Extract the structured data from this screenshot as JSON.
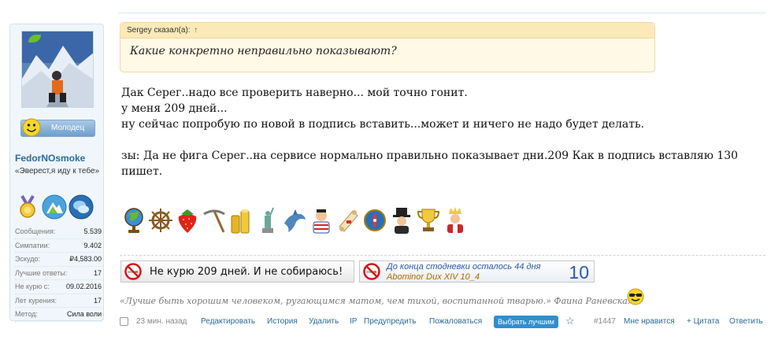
{
  "user": {
    "rank_label": "Молодец",
    "username": "FedorNOsmoke",
    "title": "«Эверест,я иду к тебе»",
    "stats": [
      {
        "key": "Сообщения:",
        "value": "5.539"
      },
      {
        "key": "Симпатии:",
        "value": "9.402"
      },
      {
        "key": "Эскудо:",
        "value": "₽4,583.00"
      },
      {
        "key": "Лучшие ответы:",
        "value": "17"
      },
      {
        "key": "Не курю с:",
        "value": "09.02.2016"
      },
      {
        "key": "Лет курения:",
        "value": "17"
      },
      {
        "key": "Метод:",
        "value": "Сила воли"
      }
    ]
  },
  "quote": {
    "author": "Sergey сказал(а):",
    "arrow": "↑",
    "text": "Какие конкретно неправильно показывают?"
  },
  "message": {
    "line1": "Дак Серег..надо все проверить наверно... мой точно гонит.",
    "line2": "у меня 209 дней...",
    "line3": "ну сейчас попробую по новой в подпись вставить...может и ничего не надо будет делать.",
    "line4": "зы: Да не фига Серег..на сервисе нормально правильно показывает дни.209 Как в подпись вставляю 130 пишет."
  },
  "smileys": [
    "globe-icon",
    "ship-wheel-icon",
    "strawberry-icon",
    "pickaxe-icon",
    "gold-coins-icon",
    "statue-of-liberty-icon",
    "dolphin-icon",
    "sailor-icon",
    "scroll-icon",
    "compass-icon",
    "gentleman-icon",
    "trophy-cup-icon",
    "king-icon"
  ],
  "banners": {
    "left_text": "Не курю 209 дней. И не собираюсь!",
    "right_line1": "До конца стодневки осталось 44 дня",
    "right_line2": "Abominor Dux XIV 10_4",
    "right_number": "10"
  },
  "signature": {
    "text": "«Лучше быть хорошим человеком, ругающимся матом, чем тихой, воспитанной тварью.» Фаина Раневская©"
  },
  "actions": {
    "time": "23 мин. назад",
    "edit": "Редактировать",
    "history": "История",
    "delete": "Удалить",
    "ip": "IP",
    "warn": "Предупредить",
    "report": "Пожаловаться",
    "best": "Выбрать лучшим",
    "star": "☆",
    "post_number": "#1447",
    "like": "Мне нравится",
    "quote": "+ Цитата",
    "reply": "Ответить"
  },
  "colors": {
    "link": "#2b6a9c",
    "quote_bg": "#fff9e6",
    "panel_bg": "#f0f6fb",
    "best_button": "#2f8fd0"
  }
}
